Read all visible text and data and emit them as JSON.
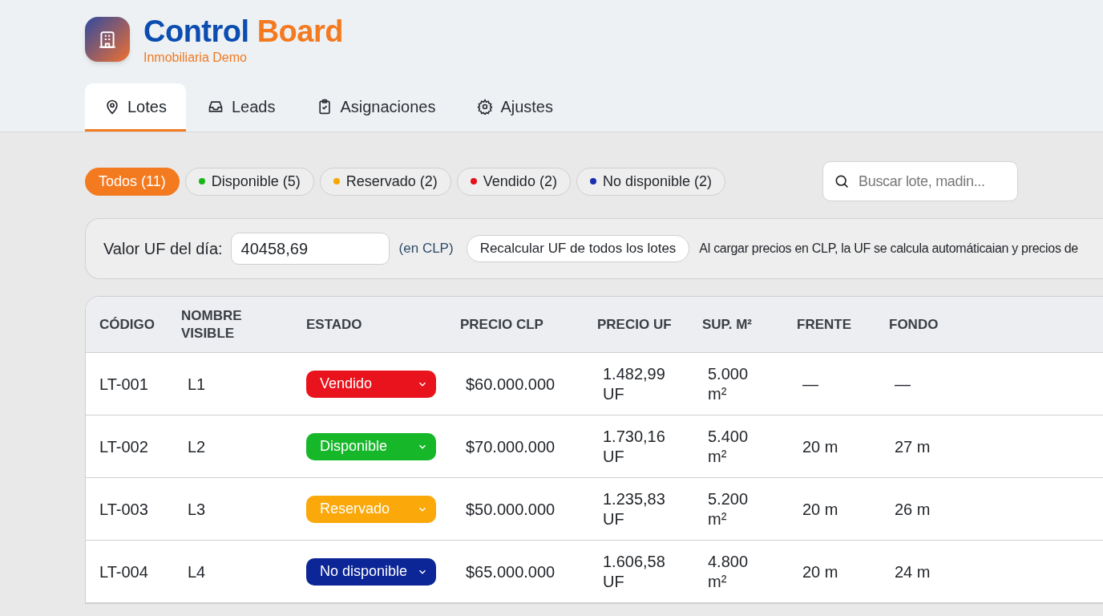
{
  "brand": {
    "title_part_1": "Control",
    "title_part_2": "Board",
    "subtitle": "Inmobiliaria Demo"
  },
  "tabs": [
    {
      "label": "Lotes",
      "selected": true
    },
    {
      "label": "Leads",
      "selected": false
    },
    {
      "label": "Asignaciones",
      "selected": false
    },
    {
      "label": "Ajustes",
      "selected": false
    }
  ],
  "filters": [
    {
      "label": "Todos (11)",
      "selected": true
    },
    {
      "label": "Disponible (5)",
      "color": "#16b616",
      "selected": false
    },
    {
      "label": "Reservado (2)",
      "color": "#f5a800",
      "selected": false
    },
    {
      "label": "Vendido (2)",
      "color": "#e3121b",
      "selected": false
    },
    {
      "label": "No disponible (2)",
      "color": "#1a2fb0",
      "selected": false
    }
  ],
  "search": {
    "placeholder": "Buscar lote, madin..."
  },
  "uf_bar": {
    "label": "Valor UF del día:",
    "value": "40458,69",
    "unit": "(en CLP)",
    "button": "Recalcular UF de todos los lotes",
    "note": "Al cargar precios en CLP, la UF se calcula automáticaian y precios de"
  },
  "table": {
    "columns": [
      "CÓDIGO",
      "NOMBRE VISIBLE",
      "ESTADO",
      "PRECIO CLP",
      "PRECIO UF",
      "SUP. M²",
      "FRENTE",
      "FONDO"
    ],
    "rows": [
      {
        "code": "LT-001",
        "name": "L1",
        "status": "Vendido",
        "color": "#e8131c",
        "price_clp": "$60.000.000",
        "price_uf": "1.482,99 UF",
        "area": "5.000 m²",
        "front": "—",
        "depth": "—"
      },
      {
        "code": "LT-002",
        "name": "L2",
        "status": "Disponible",
        "color": "#16b82a",
        "price_clp": "$70.000.000",
        "price_uf": "1.730,16 UF",
        "area": "5.400 m²",
        "front": "20 m",
        "depth": "27 m"
      },
      {
        "code": "LT-003",
        "name": "L3",
        "status": "Reservado",
        "color": "#fba80a",
        "price_clp": "$50.000.000",
        "price_uf": "1.235,83 UF",
        "area": "5.200 m²",
        "front": "20 m",
        "depth": "26 m"
      },
      {
        "code": "LT-004",
        "name": "L4",
        "status": "No disponible",
        "color": "#0c2597",
        "price_clp": "$65.000.000",
        "price_uf": "1.606,58 UF",
        "area": "4.800 m²",
        "front": "20 m",
        "depth": "24 m"
      }
    ]
  }
}
